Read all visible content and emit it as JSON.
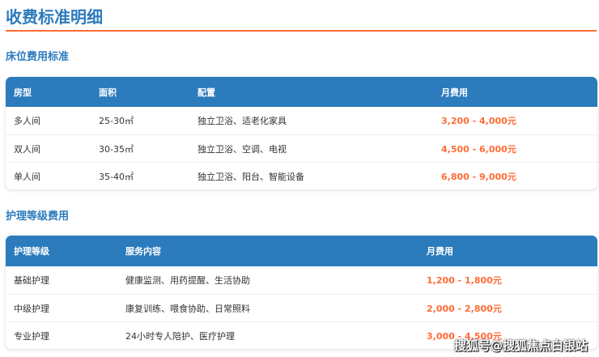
{
  "title": "收费标准明细",
  "bed": {
    "title": "床位费用标准",
    "headers": [
      "房型",
      "面积",
      "配置",
      "月费用"
    ],
    "rows": [
      [
        "多人间",
        "25-30㎡",
        "独立卫浴、适老化家具",
        "3,200 - 4,000元"
      ],
      [
        "双人间",
        "30-35㎡",
        "独立卫浴、空调、电视",
        "4,500 - 6,000元"
      ],
      [
        "单人间",
        "35-40㎡",
        "独立卫浴、阳台、智能设备",
        "6,800 - 9,000元"
      ]
    ]
  },
  "care": {
    "title": "护理等级费用",
    "headers": [
      "护理等级",
      "服务内容",
      "月费用"
    ],
    "rows": [
      [
        "基础护理",
        "健康监测、用药提醒、生活协助",
        "1,200 - 1,800元"
      ],
      [
        "中级护理",
        "康复训练、喂食协助、日常照料",
        "2,000 - 2,800元"
      ],
      [
        "专业护理",
        "24小时专人陪护、医疗护理",
        "3,000 - 4,500元"
      ]
    ]
  },
  "watermark": "搜狐号@搜狐焦点白银站",
  "colors": {
    "accent": "#2b7bbd",
    "fee": "#ff6b35"
  }
}
